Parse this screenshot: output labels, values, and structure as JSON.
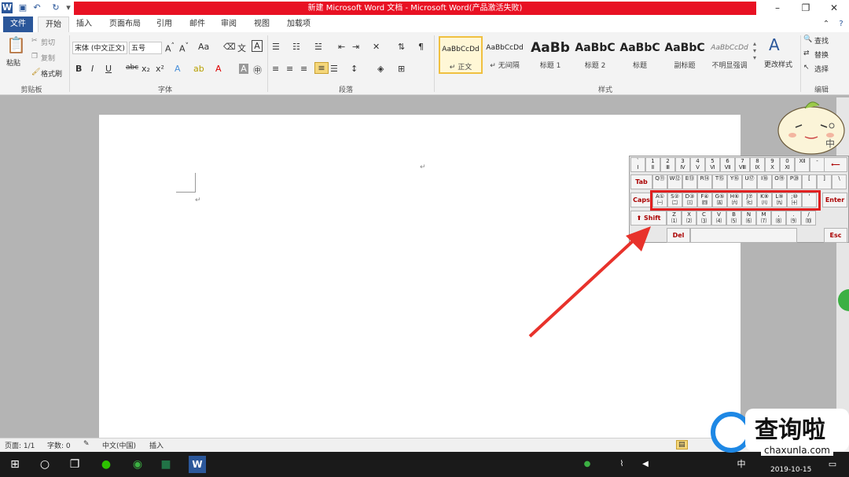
{
  "window": {
    "title": "新建 Microsoft Word 文档 - Microsoft Word(产品激活失败)",
    "app_icon": "word-icon",
    "controls": {
      "minimize": "–",
      "maximize": "❐",
      "close": "✕"
    }
  },
  "tabs": [
    "文件",
    "开始",
    "插入",
    "页面布局",
    "引用",
    "邮件",
    "审阅",
    "视图",
    "加载项"
  ],
  "ribbon": {
    "clipboard": {
      "paste": "粘贴",
      "cut": "剪切",
      "copy": "复制",
      "format_painter": "格式刷",
      "label": "剪贴板"
    },
    "font": {
      "font_name": "宋体 (中文正文)",
      "font_size": "五号",
      "label": "字体"
    },
    "paragraph": {
      "label": "段落"
    },
    "styles": {
      "label": "样式",
      "items": [
        {
          "sample": "AaBbCcDd",
          "name": "↵ 正文"
        },
        {
          "sample": "AaBbCcDd",
          "name": "↵ 无间隔"
        },
        {
          "sample": "AaBb",
          "name": "标题 1"
        },
        {
          "sample": "AaBbC",
          "name": "标题 2"
        },
        {
          "sample": "AaBbC",
          "name": "标题"
        },
        {
          "sample": "AaBbC",
          "name": "副标题"
        },
        {
          "sample": "AaBbCcDd",
          "name": "不明显强调"
        }
      ],
      "change_styles": "更改样式"
    },
    "editing": {
      "find": "查找",
      "replace": "替换",
      "select": "选择",
      "label": "编辑"
    }
  },
  "document": {
    "para_mark": "↵"
  },
  "statusbar": {
    "page": "页面: 1/1",
    "words": "字数: 0",
    "language": "中文(中国)",
    "mode": "插入"
  },
  "keyboard": {
    "row1": [
      "Ⅰ",
      "Ⅱ",
      "Ⅲ",
      "Ⅳ",
      "Ⅴ",
      "Ⅵ",
      "Ⅶ",
      "Ⅷ",
      "Ⅸ",
      "Ⅹ",
      "Ⅺ",
      "Ⅻ",
      "-",
      "="
    ],
    "row1_top": [
      "`",
      "1",
      "2",
      "3",
      "4",
      "5",
      "6",
      "7",
      "8",
      "9",
      "0",
      "",
      ""
    ],
    "row2": [
      "⑪",
      "⑫",
      "⑬",
      "⑭",
      "⑮",
      "⑯",
      "⑰",
      "⑱",
      "⑲",
      "⑳",
      "",
      "",
      ""
    ],
    "row2_letters": [
      "Q",
      "W",
      "E",
      "R",
      "T",
      "Y",
      "U",
      "I",
      "O",
      "P",
      "[",
      "]",
      "\\"
    ],
    "row3": [
      "㈠",
      "㈡",
      "㈢",
      "㈣",
      "㈤",
      "㈥",
      "㈦",
      "㈧",
      "㈨",
      "㈩",
      "",
      ""
    ],
    "row3_letters": [
      "A①",
      "S②",
      "D③",
      "F④",
      "G⑤",
      "H⑥",
      "J⑦",
      "K⑧",
      "L⑨",
      ";⑩",
      "'"
    ],
    "row4": [
      "⑴",
      "⑵",
      "⑶",
      "⑷",
      "⑸",
      "⑹",
      "⑺",
      "⑻",
      "⑼",
      "⑽"
    ],
    "row4_letters": [
      "Z",
      "X",
      "C",
      "V",
      "B",
      "N",
      "M",
      ",",
      ".",
      "/"
    ],
    "tab": "Tab",
    "caps": "Caps",
    "shift": "Shift",
    "enter": "Enter",
    "del": "Del",
    "esc": "Esc",
    "backspace": "⟵"
  },
  "taskbar": {
    "date": "2019-10-15",
    "ime": "中"
  },
  "watermark": {
    "brand": "查询啦",
    "domain": "chaxunla.com"
  },
  "mascot_text": "中",
  "colors": {
    "word_blue": "#2b579a",
    "title_red": "#e81123",
    "highlight_red": "#e02020",
    "arrow_red": "#e8322b"
  }
}
